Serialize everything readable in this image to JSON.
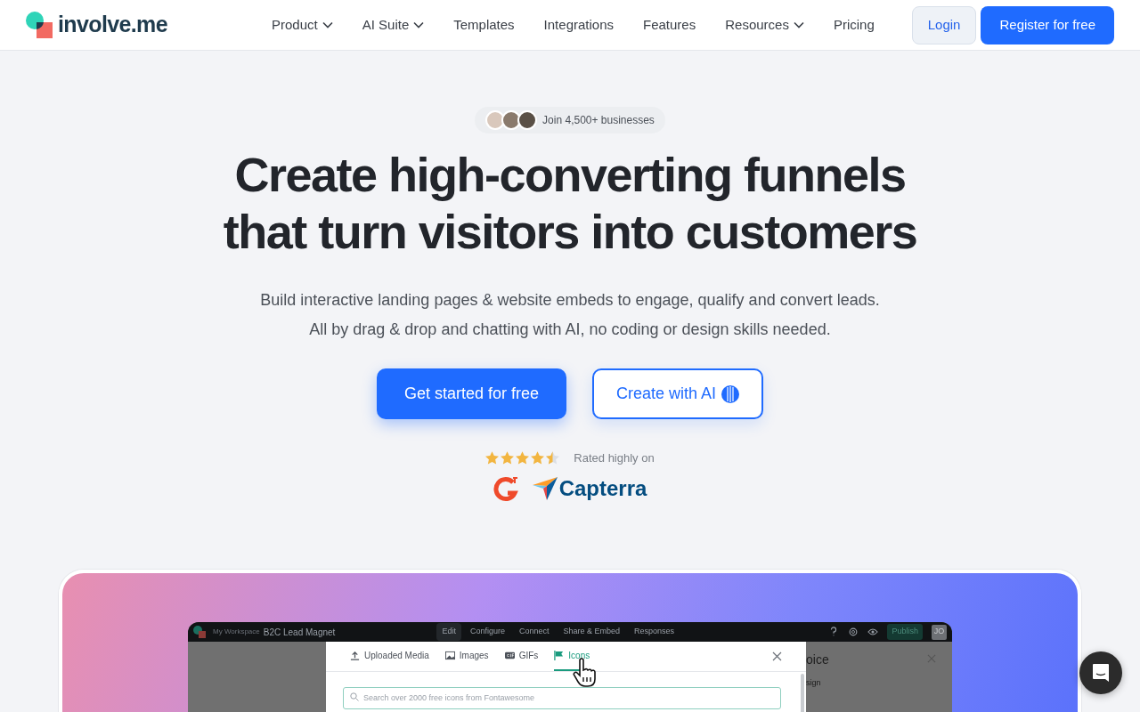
{
  "nav": {
    "logo": "involve.me",
    "items": [
      {
        "label": "Product",
        "dropdown": true
      },
      {
        "label": "AI Suite",
        "dropdown": true
      },
      {
        "label": "Templates",
        "dropdown": false
      },
      {
        "label": "Integrations",
        "dropdown": false
      },
      {
        "label": "Features",
        "dropdown": false
      },
      {
        "label": "Resources",
        "dropdown": true
      },
      {
        "label": "Pricing",
        "dropdown": false
      }
    ],
    "login": "Login",
    "register": "Register for free"
  },
  "hero": {
    "badge": "Join 4,500+ businesses",
    "title": [
      "Create high-converting funnels",
      "that turn visitors into customers"
    ],
    "subtitle": [
      "Build interactive landing pages & website embeds to engage, qualify and convert leads.",
      "All by drag & drop and chatting with AI, no coding or design skills needed."
    ],
    "primary_button": "Get started for free",
    "secondary_button": "Create with AI",
    "rating": {
      "stars": 4.5,
      "label": "Rated highly on",
      "brand": "Capterra"
    }
  },
  "app": {
    "breadcrumb": "My Workspace",
    "project": "B2C Lead Magnet",
    "tabs": [
      {
        "label": "Edit",
        "selected": true
      },
      {
        "label": "Configure",
        "selected": false
      },
      {
        "label": "Connect",
        "selected": false
      },
      {
        "label": "Share & Embed",
        "selected": false
      },
      {
        "label": "Responses",
        "selected": false
      }
    ],
    "publish": "Publish",
    "avatar": "JO",
    "modal": {
      "tabs": [
        {
          "label": "Uploaded Media",
          "kind": "upload",
          "selected": false
        },
        {
          "label": "Images",
          "kind": "image",
          "selected": false
        },
        {
          "label": "GIFs",
          "kind": "gif",
          "selected": false
        },
        {
          "label": "Icons",
          "kind": "flag",
          "selected": true
        }
      ],
      "search": {
        "placeholder": "Search over 2000 free icons from Fontawesome"
      }
    },
    "side_panel": {
      "title": "oice",
      "label": "sign"
    }
  }
}
